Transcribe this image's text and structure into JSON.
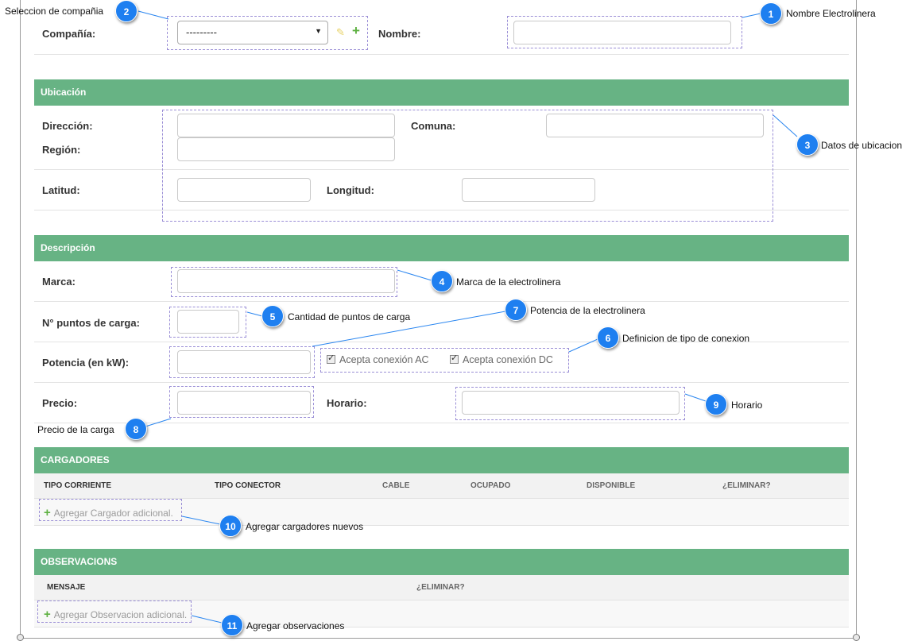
{
  "ruler": {
    "left": "100",
    "right1": "1000",
    "right2": "1100"
  },
  "company": {
    "label": "Compañía:",
    "selected": "---------"
  },
  "name_label": "Nombre:",
  "location": {
    "header": "Ubicación",
    "address_label": "Dirección:",
    "comuna_label": "Comuna:",
    "region_label": "Región:",
    "lat_label": "Latitud:",
    "lng_label": "Longitud:"
  },
  "description": {
    "header": "Descripción",
    "brand_label": "Marca:",
    "points_label": "N° puntos de carga:",
    "power_label": "Potencia (en kW):",
    "ac_label": "Acepta conexión AC",
    "dc_label": "Acepta conexión DC",
    "ac_checked": true,
    "dc_checked": true,
    "price_label": "Precio:",
    "schedule_label": "Horario:"
  },
  "chargers": {
    "header": "CARGADORES",
    "columns": [
      "TIPO CORRIENTE",
      "TIPO CONECTOR",
      "CABLE",
      "OCUPADO",
      "DISPONIBLE",
      "¿ELIMINAR?"
    ],
    "add_label": "Agregar Cargador adicional."
  },
  "observations": {
    "header": "OBSERVACIONS",
    "columns": [
      "MENSAJE",
      "¿ELIMINAR?"
    ],
    "add_label": "Agregar Observacion adicional."
  },
  "annotations": [
    {
      "num": "1",
      "text": "Nombre Electrolinera"
    },
    {
      "num": "2",
      "text": "Seleccion de compañia"
    },
    {
      "num": "3",
      "text": "Datos de ubicacion"
    },
    {
      "num": "4",
      "text": "Marca de la electrolinera"
    },
    {
      "num": "5",
      "text": "Cantidad de puntos de carga"
    },
    {
      "num": "6",
      "text": "Definicion de tipo de conexion"
    },
    {
      "num": "7",
      "text": "Potencia de la electrolinera"
    },
    {
      "num": "8",
      "text": "Precio de la carga"
    },
    {
      "num": "9",
      "text": "Horario"
    },
    {
      "num": "10",
      "text": "Agregar cargadores nuevos"
    },
    {
      "num": "11",
      "text": "Agregar observaciones"
    }
  ],
  "colors": {
    "section_header": "#67b384",
    "badge": "#1e7ff0",
    "dashed_outline": "#9a8ed6",
    "add_plus": "#5db040",
    "edit_pencil": "#e8d36a"
  },
  "icons": [
    "pencil-icon",
    "plus-icon",
    "chevron-down-icon",
    "checkbox-icon"
  ]
}
